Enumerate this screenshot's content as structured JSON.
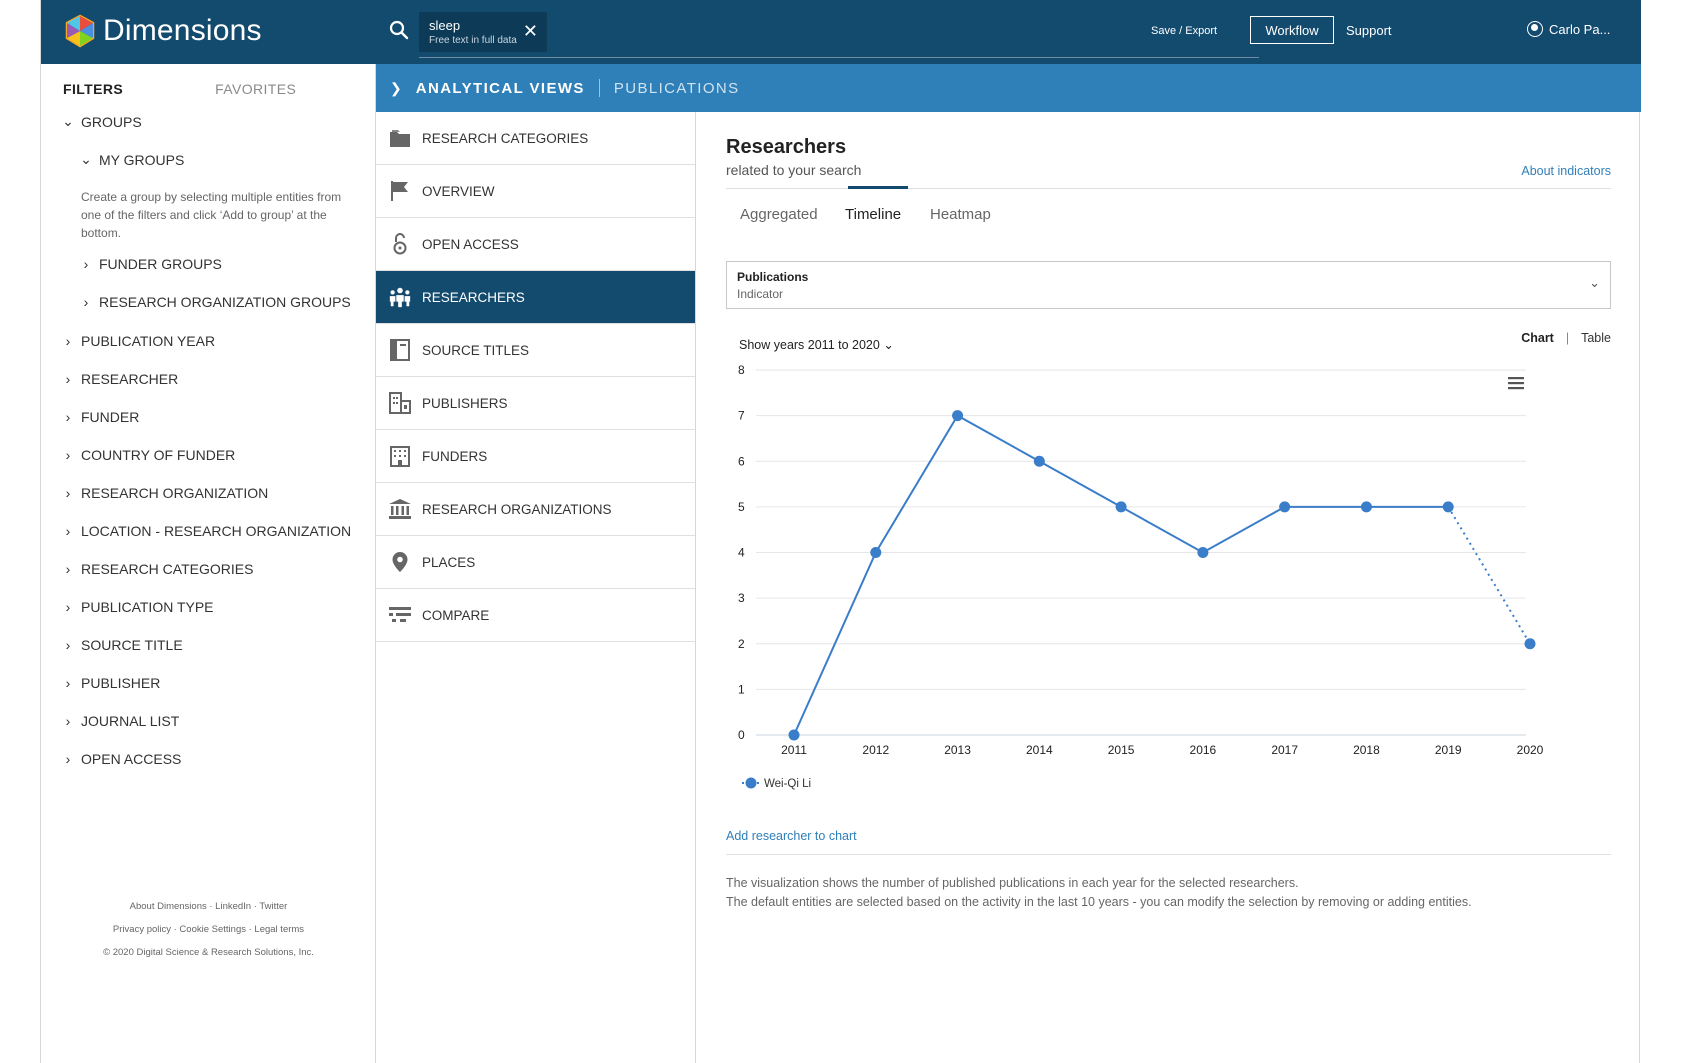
{
  "header": {
    "app_name": "Dimensions",
    "search_chip": {
      "term": "sleep",
      "scope": "Free text in full data"
    },
    "save_export": "Save / Export",
    "workflow": "Workflow",
    "support": "Support",
    "user_name": "Carlo Pa..."
  },
  "filters": {
    "tab_filters": "FILTERS",
    "tab_favorites": "FAVORITES",
    "groups": "GROUPS",
    "my_groups": "MY GROUPS",
    "groups_help": "Create a group by selecting multiple entities from one of the filters and click ‘Add to group’ at the bottom.",
    "funder_groups": "FUNDER GROUPS",
    "research_org_groups": "RESEARCH ORGANIZATION GROUPS",
    "items": [
      "PUBLICATION YEAR",
      "RESEARCHER",
      "FUNDER",
      "COUNTRY OF FUNDER",
      "RESEARCH ORGANIZATION",
      "LOCATION - RESEARCH ORGANIZATION",
      "RESEARCH CATEGORIES",
      "PUBLICATION TYPE",
      "SOURCE TITLE",
      "PUBLISHER",
      "JOURNAL LIST",
      "OPEN ACCESS"
    ],
    "footer": {
      "line1": "About Dimensions · LinkedIn · Twitter",
      "line2": "Privacy policy · Cookie Settings · Legal terms",
      "line3": "© 2020 Digital Science & Research Solutions, Inc."
    }
  },
  "analytical_bar": {
    "title": "ANALYTICAL VIEWS",
    "subtitle": "PUBLICATIONS"
  },
  "views": [
    {
      "label": "RESEARCH CATEGORIES",
      "icon": "folder-icon"
    },
    {
      "label": "OVERVIEW",
      "icon": "flag-icon"
    },
    {
      "label": "OPEN ACCESS",
      "icon": "open-lock-icon"
    },
    {
      "label": "RESEARCHERS",
      "icon": "people-icon",
      "active": true
    },
    {
      "label": "SOURCE TITLES",
      "icon": "book-icon"
    },
    {
      "label": "PUBLISHERS",
      "icon": "buildings-icon"
    },
    {
      "label": "FUNDERS",
      "icon": "building-icon"
    },
    {
      "label": "RESEARCH ORGANIZATIONS",
      "icon": "institution-icon"
    },
    {
      "label": "PLACES",
      "icon": "map-pin-icon"
    },
    {
      "label": "COMPARE",
      "icon": "compare-icon"
    }
  ],
  "main": {
    "title": "Researchers",
    "subtitle": "related to your search",
    "about_link": "About indicators",
    "tabs": [
      "Aggregated",
      "Timeline",
      "Heatmap"
    ],
    "active_tab": "Timeline",
    "indicator_label": "Publications",
    "indicator_sub": "Indicator",
    "years_select": "Show years 2011 to 2020",
    "chart_toggle": {
      "chart": "Chart",
      "table": "Table"
    },
    "add_researcher": "Add researcher to chart",
    "note_line1": "The visualization shows the number of published publications in each year for the selected researchers.",
    "note_line2": "The default entities are selected based on the activity in the last 10 years - you can modify the selection by removing or adding entities."
  },
  "colors": {
    "header": "#134b6e",
    "accent_bar": "#2f7fb8",
    "series": "#3a7dc9",
    "link": "#2f7fb8"
  },
  "chart_data": {
    "type": "line",
    "x": [
      "2011",
      "2012",
      "2013",
      "2014",
      "2015",
      "2016",
      "2017",
      "2018",
      "2019",
      "2020"
    ],
    "series": [
      {
        "name": "Wei-Qi Li",
        "values": [
          0,
          4,
          7,
          6,
          5,
          4,
          5,
          5,
          5,
          2
        ],
        "last_segment_dotted": true
      }
    ],
    "ylim": [
      0,
      8
    ],
    "yticks": [
      0,
      1,
      2,
      3,
      4,
      5,
      6,
      7,
      8
    ],
    "grid": true,
    "legend": "bottom-left"
  }
}
